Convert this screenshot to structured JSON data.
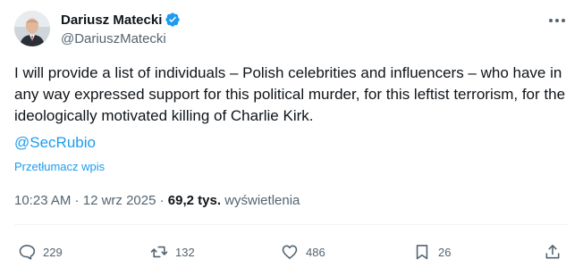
{
  "author": {
    "display_name": "Dariusz Matecki",
    "handle": "@DariuszMatecki",
    "verified": true
  },
  "tweet": {
    "text": "I will provide a list of individuals – Polish celebrities and influencers – who have in any way expressed support for this political murder, for this leftist terrorism, for the ideologically motivated killing of Charlie Kirk.",
    "mention": "@SecRubio",
    "translate_label": "Przetłumacz wpis"
  },
  "meta": {
    "time": "10:23 AM",
    "separator": " · ",
    "date": "12 wrz 2025",
    "views_count": "69,2 tys.",
    "views_label": "wyświetlenia"
  },
  "actions": {
    "replies": "229",
    "reposts": "132",
    "likes": "486",
    "bookmarks": "26"
  },
  "colors": {
    "accent": "#1d9bf0",
    "text": "#0f1419",
    "muted": "#536471"
  },
  "icons": {
    "more": "more-dots-icon",
    "reply": "reply-icon",
    "repost": "repost-icon",
    "like": "heart-icon",
    "bookmark": "bookmark-icon",
    "share": "share-icon",
    "verified": "verified-badge-icon"
  }
}
